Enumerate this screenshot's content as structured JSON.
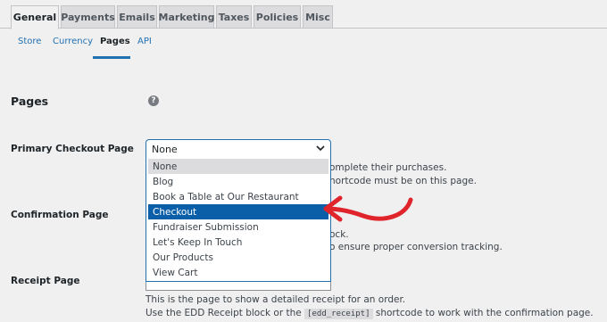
{
  "tabs": [
    "General",
    "Payments",
    "Emails",
    "Marketing",
    "Taxes",
    "Policies",
    "Misc"
  ],
  "subtabs": [
    "Store",
    "Currency",
    "Pages",
    "API"
  ],
  "section_title": "Pages",
  "help_icon": "?",
  "rows": {
    "primary_checkout": "Primary Checkout Page",
    "confirmation": "Confirmation Page",
    "receipt": "Receipt Page"
  },
  "select": {
    "value": "None",
    "options": [
      "None",
      "Blog",
      "Book a Table at Our Restaurant",
      "Checkout",
      "Fundraiser Submission",
      "Let's Keep In Touch",
      "Our Products",
      "View Cart"
    ]
  },
  "descriptions": {
    "checkout_1": "omplete their purchases.",
    "checkout_2": "hortcode must be on this page.",
    "confirmation_1": "ock.",
    "confirmation_2": "o ensure proper conversion tracking.",
    "receipt_1": "This is the page to show a detailed receipt for an order.",
    "receipt_2_pre": "Use the EDD Receipt block or the",
    "receipt_2_code": "[edd_receipt]",
    "receipt_2_post": "shortcode to work with the confirmation page."
  },
  "colors": {
    "accent": "#2271b1",
    "selected": "#0a5fa8",
    "arrow": "#e0242b"
  }
}
